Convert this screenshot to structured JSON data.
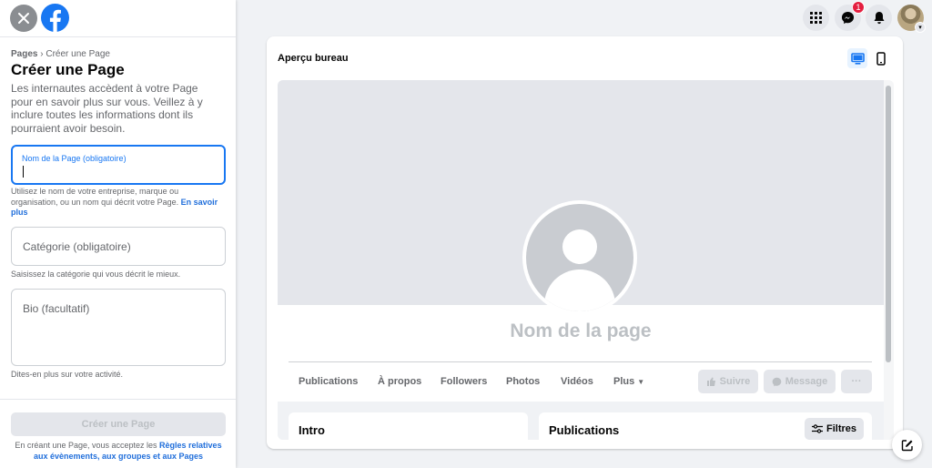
{
  "sidebar": {
    "breadcrumb_root": "Pages",
    "breadcrumb_sep": " › ",
    "breadcrumb_current": "Créer une Page",
    "title": "Créer une Page",
    "description": "Les internautes accèdent à votre Page pour en savoir plus sur vous. Veillez à y inclure toutes les informations dont ils pourraient avoir besoin.",
    "name_field": {
      "label": "Nom de la Page (obligatoire)",
      "value": "",
      "hint": "Utilisez le nom de votre entreprise, marque ou organisation, ou un nom qui décrit votre Page. ",
      "hint_link": "En savoir plus"
    },
    "category_field": {
      "placeholder": "Catégorie (obligatoire)",
      "hint": "Saisissez la catégorie qui vous décrit le mieux."
    },
    "bio_field": {
      "placeholder": "Bio (facultatif)",
      "hint": "Dites-en plus sur votre activité."
    },
    "create_button": "Créer une Page",
    "terms_prefix": "En créant une Page, vous acceptez les ",
    "terms_link": "Règles relatives aux évènements, aux groupes et aux Pages"
  },
  "topbar": {
    "messenger_badge": "1",
    "icons": [
      "menu-grid-icon",
      "messenger-icon",
      "bell-icon",
      "avatar"
    ]
  },
  "preview": {
    "title": "Aperçu bureau",
    "page_name": "Nom de la page",
    "tabs": [
      "Publications",
      "À propos",
      "Followers",
      "Photos",
      "Vidéos",
      "Plus"
    ],
    "actions": {
      "follow": "Suivre",
      "message": "Message",
      "more": "···"
    },
    "intro_title": "Intro",
    "publications_title": "Publications",
    "filters_button": "Filtres"
  },
  "colors": {
    "accent": "#1877f2",
    "link": "#216fdb",
    "badge": "#e41e3f",
    "background": "#f0f2f5"
  }
}
